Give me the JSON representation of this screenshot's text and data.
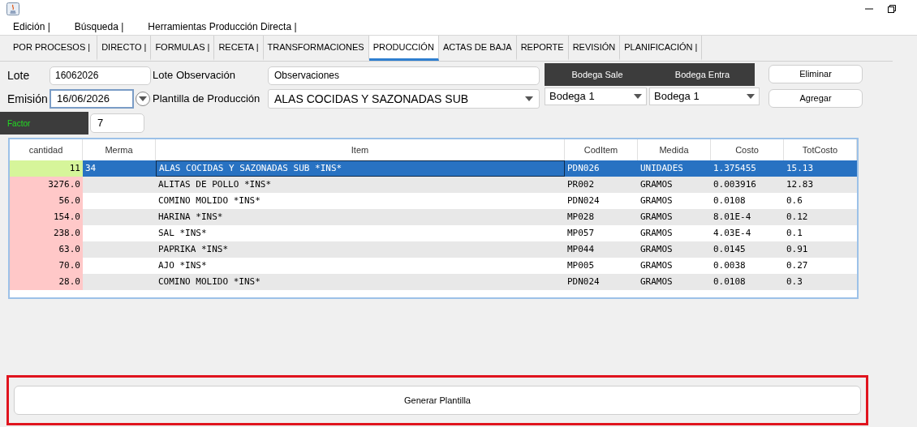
{
  "menu": [
    "Edición |",
    "Búsqueda |",
    "Herramientas Producción Directa |"
  ],
  "tabs": [
    {
      "label": "POR PROCESOS |",
      "selected": false
    },
    {
      "label": "DIRECTO |",
      "selected": false
    },
    {
      "label": "FORMULAS |",
      "selected": false
    },
    {
      "label": "RECETA |",
      "selected": false
    },
    {
      "label": "TRANSFORMACIONES",
      "selected": false
    },
    {
      "label": "PRODUCCIÓN",
      "selected": true
    },
    {
      "label": "ACTAS DE BAJA",
      "selected": false
    },
    {
      "label": "REPORTE",
      "selected": false
    },
    {
      "label": "REVISIÓN",
      "selected": false
    },
    {
      "label": "PLANIFICACIÓN |",
      "selected": false
    }
  ],
  "form": {
    "lote": {
      "label": "Lote",
      "value": "16062026"
    },
    "lote_observacion": {
      "label": "Lote Observación",
      "value": "Observaciones"
    },
    "emision": {
      "label": "Emisión",
      "value": "16/06/2026"
    },
    "plantilla": {
      "label": "Plantilla de Producción",
      "value": "ALAS COCIDAS Y SAZONADAS SUB"
    },
    "bodega_sale": {
      "label": "Bodega Sale",
      "value": "Bodega 1"
    },
    "bodega_entra": {
      "label": "Bodega Entra",
      "value": "Bodega 1"
    },
    "factor": {
      "label": "Factor",
      "value": "7"
    },
    "buttons": [
      "Eliminar",
      "Agregar"
    ]
  },
  "table": {
    "columns": [
      "cantidad",
      "Merma",
      "Item",
      "CodItem",
      "Medida",
      "Costo",
      "TotCosto"
    ],
    "rows": [
      {
        "cells": [
          "11",
          "34",
          "ALAS COCIDAS Y SAZONADAS SUB *INS*",
          "PDN026",
          "UNIDADES",
          "1.375455",
          "15.13"
        ],
        "selected": true,
        "color": "#d6f59a"
      },
      {
        "cells": [
          "3276.0",
          "",
          "ALITAS DE POLLO *INS*",
          "PR002",
          "GRAMOS",
          "0.003916",
          "12.83"
        ],
        "selected": false,
        "color": "#ffc8c8"
      },
      {
        "cells": [
          "56.0",
          "",
          "COMINO MOLIDO *INS*",
          "PDN024",
          "GRAMOS",
          "0.0108",
          "0.6"
        ],
        "selected": false,
        "color": "#ffc8c8"
      },
      {
        "cells": [
          "154.0",
          "",
          "HARINA *INS*",
          "MP028",
          "GRAMOS",
          "8.01E-4",
          "0.12"
        ],
        "selected": false,
        "color": "#ffc8c8"
      },
      {
        "cells": [
          "238.0",
          "",
          "SAL *INS*",
          "MP057",
          "GRAMOS",
          "4.03E-4",
          "0.1"
        ],
        "selected": false,
        "color": "#ffc8c8"
      },
      {
        "cells": [
          "63.0",
          "",
          "PAPRIKA *INS*",
          "MP044",
          "GRAMOS",
          "0.0145",
          "0.91"
        ],
        "selected": false,
        "color": "#ffc8c8"
      },
      {
        "cells": [
          "70.0",
          "",
          "AJO *INS*",
          "MP005",
          "GRAMOS",
          "0.0038",
          "0.27"
        ],
        "selected": false,
        "color": "#ffc8c8"
      },
      {
        "cells": [
          "28.0",
          "",
          "COMINO MOLIDO *INS*",
          "PDN024",
          "GRAMOS",
          "0.0108",
          "0.3"
        ],
        "selected": false,
        "color": "#ffc8c8"
      }
    ]
  },
  "footer_button": "Generar Plantilla"
}
